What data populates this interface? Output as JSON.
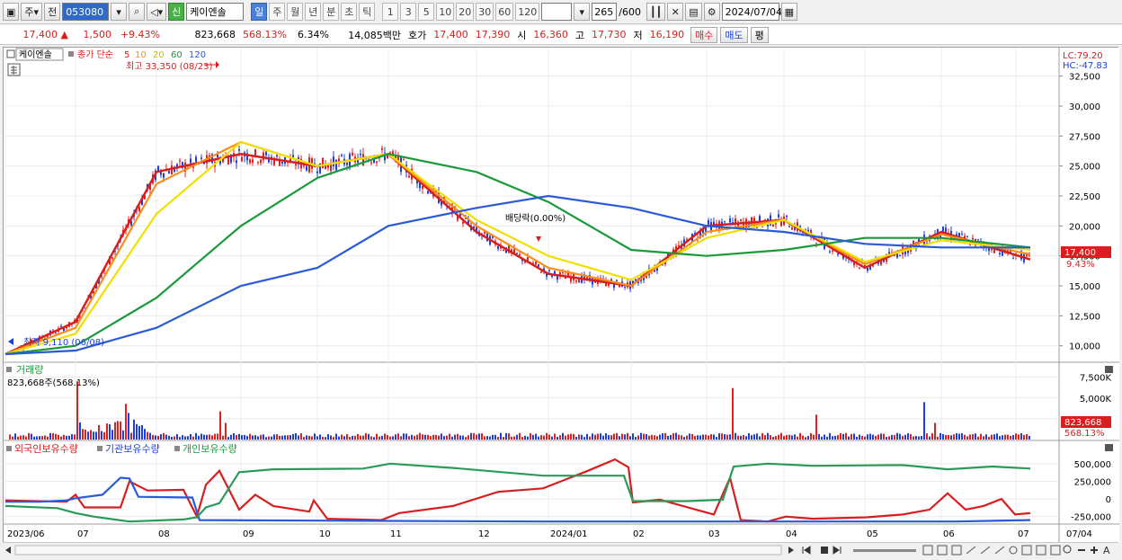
{
  "toolbar": {
    "type_label": "주",
    "prev_label": "전",
    "code": "053080",
    "new_badge": "신",
    "name": "케이엔솔",
    "periods": [
      "일",
      "주",
      "월",
      "년",
      "분",
      "초",
      "틱"
    ],
    "active_period": "일",
    "intervals": [
      "1",
      "3",
      "5",
      "10",
      "20",
      "30",
      "60",
      "120"
    ],
    "count": "265",
    "count_total": "/600",
    "date": "2024/07/04"
  },
  "quote": {
    "price": "17,400",
    "change": "1,500",
    "change_pct": "+9.43%",
    "volume": "823,668",
    "volume_ratio": "568.13%",
    "turnover": "6.34%",
    "amount": "14,085백만",
    "ask_label": "호가",
    "ask": "17,400",
    "bid": "17,390",
    "open_label": "시",
    "open": "16,360",
    "high_label": "고",
    "high": "17,730",
    "low_label": "저",
    "low": "16,190",
    "buy_label": "매수",
    "sell_label": "매도",
    "eval_label": "평"
  },
  "price_panel": {
    "name_tag": "케이엔솔",
    "ma_label": "종가 단순",
    "ma_periods": [
      "5",
      "10",
      "20",
      "60",
      "120"
    ],
    "ma_colors": [
      "#d81e1e",
      "#ff8c1a",
      "#f0e000",
      "#1a9a3a",
      "#2a5ad8"
    ],
    "high_note": "최고 33,350 (08/23)",
    "low_note": "최저 9,110 (06/08)",
    "dividend_note": "배당락(0.00%)",
    "lc": "LC:79.20",
    "hc": "HC:-47.83",
    "price_tag": "17,400",
    "pct_tag": "9.43%",
    "y_ticks": [
      "32,500",
      "30,000",
      "27,500",
      "25,000",
      "22,500",
      "20,000",
      "17,500",
      "15,000",
      "12,500",
      "10,000"
    ]
  },
  "volume_panel": {
    "title": "거래량",
    "info": "823,668주(568.13%)",
    "y_ticks": [
      "7,500K",
      "5,000K",
      "2,500K"
    ],
    "vol_tag": "823,668",
    "pct_tag": "568.13%"
  },
  "holdings_panel": {
    "labels": [
      "외국인보유수량",
      "기관보유수량",
      "개인보유수량"
    ],
    "y_ticks": [
      "500,000",
      "250,000",
      "0",
      "-250,000"
    ]
  },
  "x_axis": [
    "2023/06",
    "07",
    "08",
    "09",
    "10",
    "11",
    "12",
    "2024/01",
    "02",
    "03",
    "04",
    "05",
    "06",
    "07"
  ],
  "x_axis_right": "07/04",
  "chart_data": {
    "type": "line",
    "x": [
      "2023/06",
      "07",
      "08",
      "09",
      "10",
      "11",
      "12",
      "2024/01",
      "02",
      "03",
      "04",
      "05",
      "06",
      "07"
    ],
    "series": [
      {
        "name": "5",
        "values": [
          9300,
          12000,
          24500,
          26000,
          25000,
          26000,
          19500,
          16000,
          15000,
          20000,
          20500,
          16500,
          19500,
          17200
        ]
      },
      {
        "name": "10",
        "values": [
          9300,
          11500,
          23500,
          27000,
          25000,
          26000,
          20000,
          16500,
          15000,
          19500,
          20500,
          16800,
          19300,
          17600
        ]
      },
      {
        "name": "20",
        "values": [
          9300,
          11000,
          21000,
          27000,
          25000,
          26000,
          20500,
          17500,
          15500,
          19000,
          20500,
          17000,
          18800,
          18000
        ]
      },
      {
        "name": "60",
        "values": [
          9300,
          10000,
          14000,
          20000,
          24000,
          26000,
          24500,
          22000,
          18000,
          17500,
          18000,
          19000,
          19000,
          18200
        ]
      },
      {
        "name": "120",
        "values": [
          9300,
          9600,
          11500,
          15000,
          16500,
          20000,
          21500,
          22500,
          21500,
          20000,
          19500,
          18500,
          18200,
          18200
        ]
      }
    ],
    "ylim": [
      9000,
      33000
    ]
  }
}
